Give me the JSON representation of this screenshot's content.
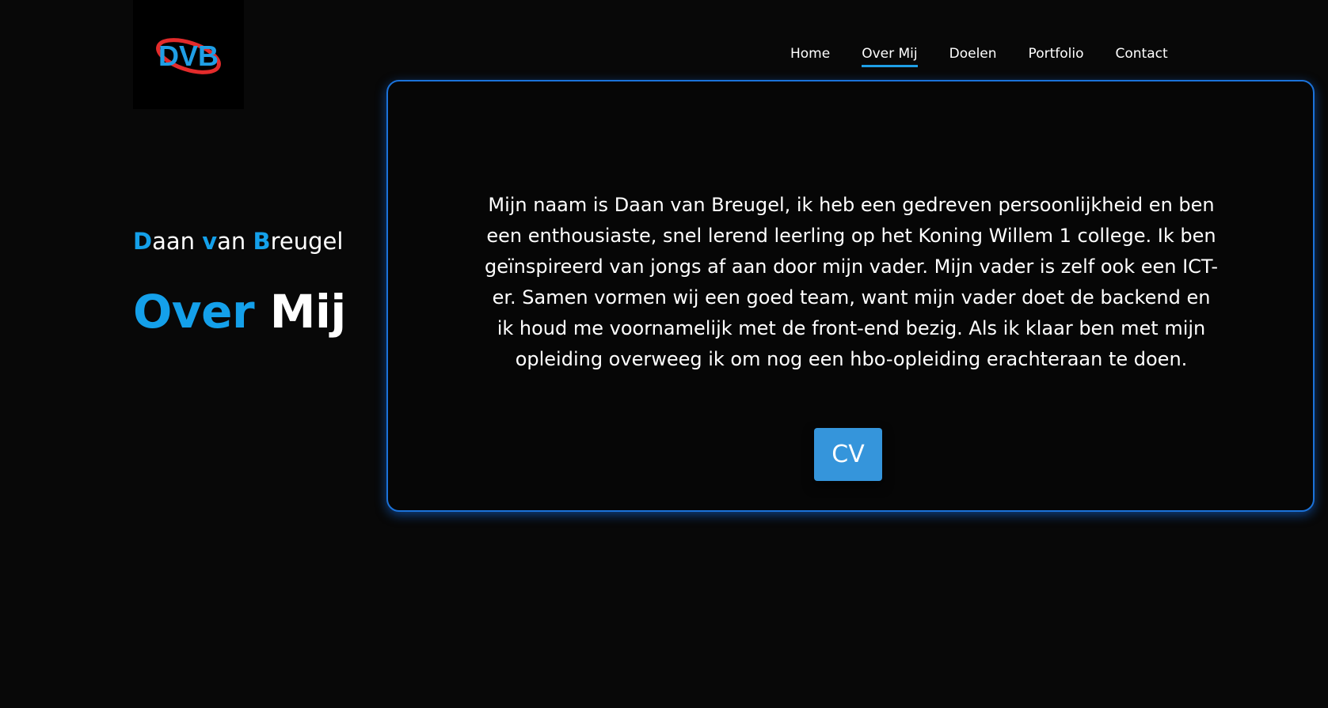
{
  "logo": {
    "text": "DVB",
    "colors": {
      "letters": "#1f9fe6",
      "swoosh": "#e32b2b",
      "background": "#000000"
    }
  },
  "nav": {
    "items": [
      {
        "label": "Home",
        "active": false
      },
      {
        "label": "Over Mij",
        "active": true
      },
      {
        "label": "Doelen",
        "active": false
      },
      {
        "label": "Portfolio",
        "active": false
      },
      {
        "label": "Contact",
        "active": false
      }
    ]
  },
  "hero": {
    "name_parts": [
      {
        "cap": "D",
        "rest": "aan "
      },
      {
        "cap": "v",
        "rest": "an "
      },
      {
        "cap": "B",
        "rest": "reugel"
      }
    ],
    "title_accent": "Over",
    "title_plain": "Mij"
  },
  "card": {
    "bio": "Mijn naam is Daan van Breugel, ik heb een gedreven persoonlijkheid en ben een enthousiaste, snel lerend leerling op het Koning Willem 1 college. Ik ben geïnspireerd van jongs af aan door mijn vader. Mijn vader is zelf ook een ICT-er. Samen vormen wij een goed team, want mijn vader doet de backend en ik houd me voornamelijk met de front-end bezig. Als ik klaar ben met mijn opleiding overweeg ik om nog een hbo-opleiding erachteraan te doen.",
    "cv_label": "CV"
  },
  "colors": {
    "background": "#080808",
    "accent": "#14a0ea",
    "card_border": "#1b72d9",
    "button": "#3595db"
  }
}
